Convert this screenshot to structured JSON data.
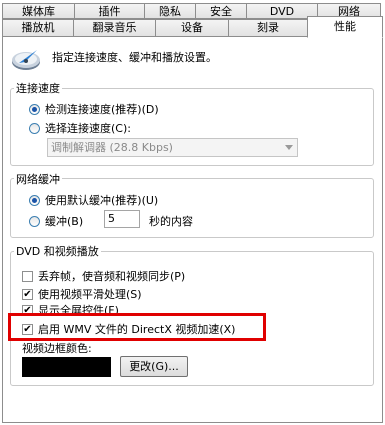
{
  "tabs_row1": [
    "媒体库",
    "插件",
    "隐私",
    "安全",
    "DVD",
    "网络"
  ],
  "tabs_row2": [
    "播放机",
    "翻录音乐",
    "设备",
    "刻录",
    "性能"
  ],
  "header": {
    "icon": "performance-gauge-icon",
    "text": "指定连接速度、缓冲和播放设置。"
  },
  "connection": {
    "title": "连接速度",
    "detect_label": "检测连接速度(推荐)(D)",
    "choose_label": "选择连接速度(C):",
    "selected": "detect",
    "dropdown_value": "调制解调器 (28.8 Kbps)"
  },
  "buffering": {
    "title": "网络缓冲",
    "default_label": "使用默认缓冲(推荐)(U)",
    "custom_label": "缓冲(B)",
    "seconds_value": "5",
    "seconds_suffix": "秒的内容",
    "selected": "default"
  },
  "dvd_video": {
    "title": "DVD 和视频播放",
    "options": [
      {
        "label": "丢弃帧，使音频和视频同步(P)",
        "checked": false
      },
      {
        "label": "使用视频平滑处理(S)",
        "checked": true
      },
      {
        "label": "显示全屏控件(F)",
        "checked": true
      },
      {
        "label": "启用 WMV 文件的 DirectX 视频加速(X)",
        "checked": true
      }
    ],
    "border_color_label": "视频边框颜色:",
    "border_color_value": "#000000",
    "change_button": "更改(G)..."
  },
  "colors": {
    "highlight": "#e00000",
    "radio_dot": "#1a53a8"
  }
}
